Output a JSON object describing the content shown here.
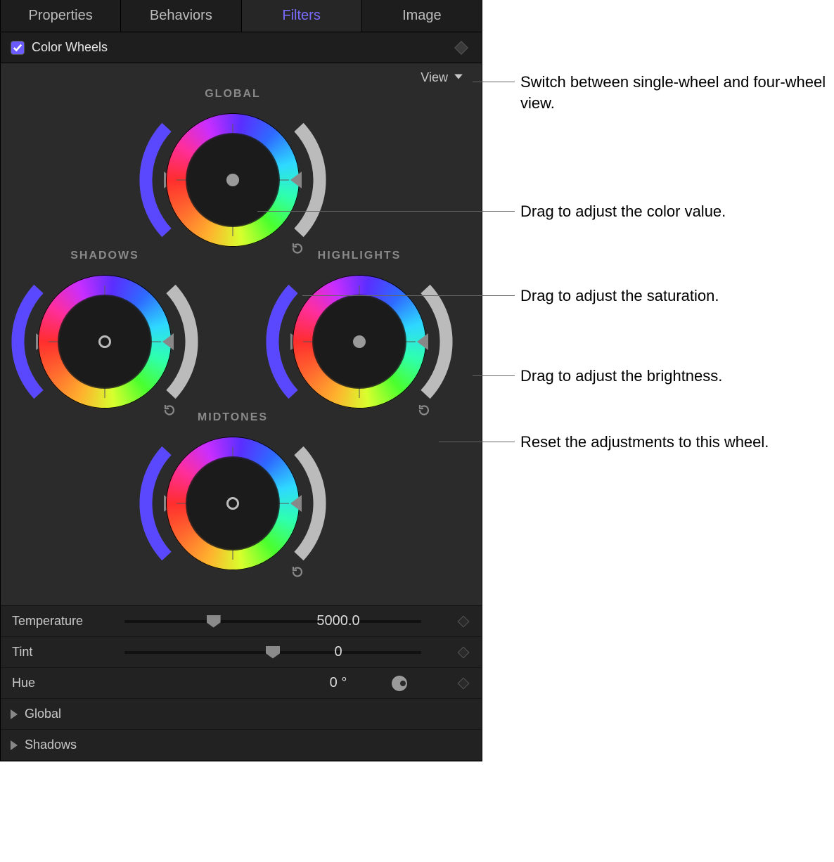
{
  "tabs": [
    "Properties",
    "Behaviors",
    "Filters",
    "Image"
  ],
  "activeTab": "Filters",
  "effect": {
    "name": "Color Wheels",
    "checked": true
  },
  "view": {
    "label": "View"
  },
  "wheels": {
    "global": {
      "label": "GLOBAL"
    },
    "shadows": {
      "label": "SHADOWS"
    },
    "highlights": {
      "label": "HIGHLIGHTS"
    },
    "midtones": {
      "label": "MIDTONES"
    }
  },
  "sliders": {
    "temperature": {
      "label": "Temperature",
      "value": "5000.0",
      "position": 30
    },
    "tint": {
      "label": "Tint",
      "value": "0",
      "position": 50
    },
    "hue": {
      "label": "Hue",
      "value": "0 °"
    }
  },
  "disclosure": {
    "global": "Global",
    "shadows": "Shadows"
  },
  "callouts": {
    "view": "Switch between single-wheel and four-wheel view.",
    "center": "Drag to adjust the color value.",
    "saturation": "Drag to adjust the saturation.",
    "brightness": "Drag to adjust the brightness.",
    "reset": "Reset the adjustments to this wheel."
  },
  "icons": {
    "check": "check-icon",
    "chevDown": "chevron-down-icon",
    "reset": "reset-icon",
    "keyframe": "keyframe-diamond-icon",
    "disclosure": "disclosure-triangle-icon"
  }
}
